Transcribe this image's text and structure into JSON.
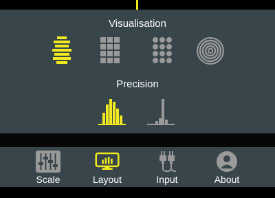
{
  "visualisation": {
    "title": "Visualisation",
    "options": [
      {
        "icon": "stacked-bars-icon",
        "selected": true
      },
      {
        "icon": "square-grid-icon",
        "selected": false
      },
      {
        "icon": "dot-grid-icon",
        "selected": false
      },
      {
        "icon": "concentric-rings-icon",
        "selected": false
      }
    ]
  },
  "precision": {
    "title": "Precision",
    "options": [
      {
        "icon": "wide-histogram-icon",
        "selected": true
      },
      {
        "icon": "narrow-histogram-icon",
        "selected": false
      }
    ]
  },
  "nav": {
    "items": [
      {
        "label": "Scale",
        "icon": "sliders-icon",
        "selected": false
      },
      {
        "label": "Layout",
        "icon": "layout-monitor-icon",
        "selected": true
      },
      {
        "label": "Input",
        "icon": "input-plugs-icon",
        "selected": false
      },
      {
        "label": "About",
        "icon": "user-circle-icon",
        "selected": false
      }
    ]
  },
  "colors": {
    "accent": "#f1ea1e",
    "icon_inactive": "#9a9a9a",
    "panel": "#38454b",
    "background": "#000000"
  }
}
